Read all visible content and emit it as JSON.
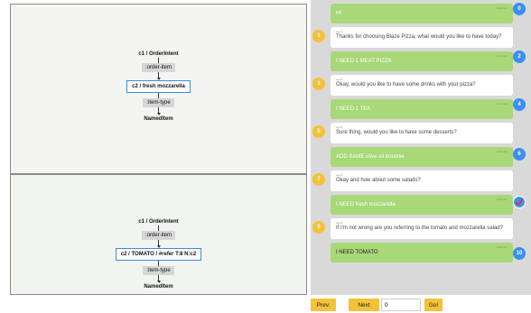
{
  "graph_top": {
    "n1": "c1 / OrderIntent",
    "l1": ":order-item",
    "n2": "c2 / fresh mozzarella",
    "l2": ":item-type",
    "n3": "NamedItem"
  },
  "graph_bottom": {
    "n1": "c1 / OrderIntent",
    "l1": ":order-item",
    "n2": "c2 / TOMATO / #refer T:8 N:c2",
    "l2": ":item-type",
    "n3": "NamedItem"
  },
  "chat": {
    "customer_tag": "customer",
    "agent_tag": "agent",
    "messages": [
      {
        "role": "customer",
        "num": "0",
        "text": "HI"
      },
      {
        "role": "agent",
        "num": "1",
        "text": "Thanks for choosing Blaze Pizza, what would you like to have today?"
      },
      {
        "role": "customer",
        "num": "2",
        "text": "I NEED 1 MEAT PIZZA"
      },
      {
        "role": "agent",
        "num": "3",
        "text": "Okay, would you like to have some drinks with your pizza?"
      },
      {
        "role": "customer",
        "num": "4",
        "text": "I NEED 1 TEA"
      },
      {
        "role": "agent",
        "num": "5",
        "text": "Sure thing, would you like to have some desserts?"
      },
      {
        "role": "customer",
        "num": "6",
        "text": "ADD SAME olive oil brownie"
      },
      {
        "role": "agent",
        "num": "7",
        "text": "Okay and how about some salads?"
      },
      {
        "role": "customer",
        "num": "8",
        "text": "I NEED fresh mozzarella"
      },
      {
        "role": "agent",
        "num": "9",
        "text": "If I'm not wrong are you referring to the tomato and mozzarella salad?"
      },
      {
        "role": "customer",
        "num": "10",
        "text": "I NEED TOMATO"
      }
    ]
  },
  "controls": {
    "prev_label": "Prev.",
    "next_label": "Next",
    "page_value": "0",
    "go_label": "Go!"
  },
  "colors": {
    "customer_bubble": "#a8d877",
    "turn_blue": "#3e8ef0",
    "turn_yellow": "#f3c23a",
    "highlight_border": "#3d8be0",
    "check_mark": "#e0303a"
  }
}
